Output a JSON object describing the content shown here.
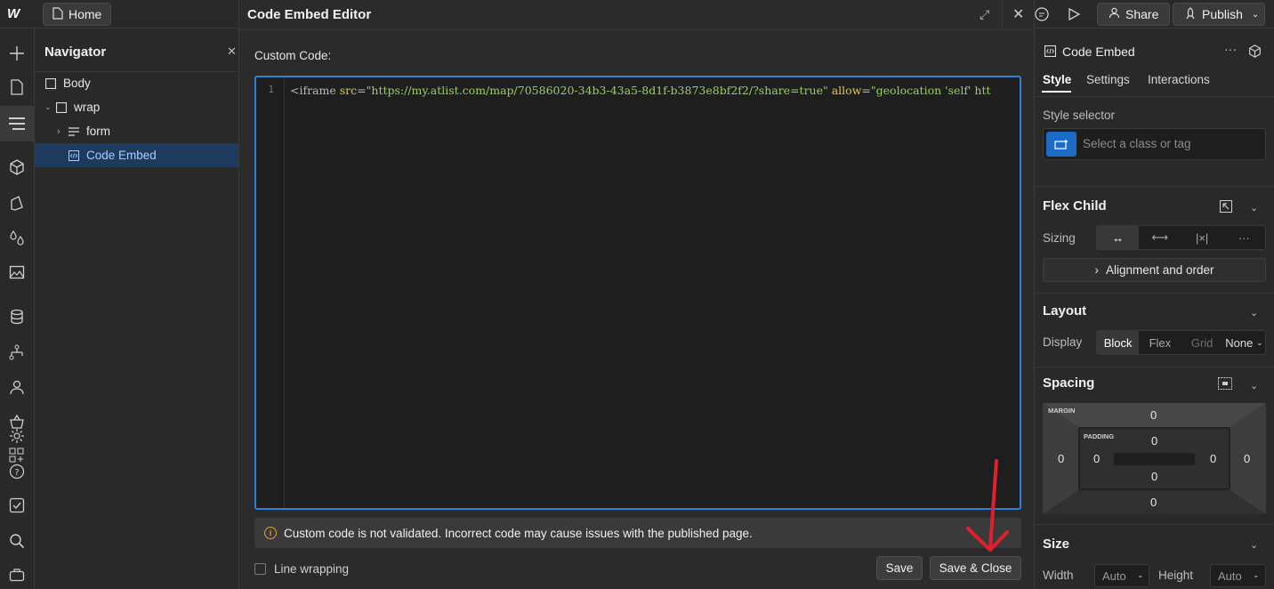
{
  "topbar": {
    "logo": "W",
    "page_label": "Home",
    "share_label": "Share",
    "publish_label": "Publish"
  },
  "navigator": {
    "title": "Navigator",
    "tree": [
      {
        "label": "Body",
        "icon": "square-icon",
        "indent": 0
      },
      {
        "label": "wrap",
        "icon": "square-icon",
        "indent": 1,
        "expanded": true
      },
      {
        "label": "form",
        "icon": "form-icon",
        "indent": 2,
        "expanded": false
      },
      {
        "label": "Code Embed",
        "icon": "code-embed-icon",
        "indent": 2,
        "selected": true
      }
    ]
  },
  "modal": {
    "title": "Code Embed Editor",
    "custom_code_label": "Custom Code:",
    "line_number": "1",
    "code": {
      "open": "<iframe",
      "attr1": "src",
      "eq": "=",
      "val1": "\"https://my.atlist.com/map/70586020-34b3-43a5-8d1f-b3873e8bf2f2/?share=true\"",
      "attr2": "allow",
      "val2": "\"geolocation 'self' htt"
    },
    "warning": "Custom code is not validated. Incorrect code may cause issues with the published page.",
    "line_wrapping_label": "Line wrapping",
    "save_label": "Save",
    "save_close_label": "Save & Close"
  },
  "right_panel": {
    "element_name": "Code Embed",
    "tabs": [
      "Style",
      "Settings",
      "Interactions"
    ],
    "active_tab": "Style",
    "style_selector_label": "Style selector",
    "selector_placeholder": "Select a class or tag",
    "flex_child_title": "Flex Child",
    "sizing_label": "Sizing",
    "alignment_label": "Alignment and order",
    "layout_title": "Layout",
    "display_label": "Display",
    "display_options": [
      "Block",
      "Flex",
      "Grid",
      "None"
    ],
    "display_active": "Block",
    "spacing_title": "Spacing",
    "margin_caption": "MARGIN",
    "padding_caption": "PADDING",
    "margin": {
      "top": "0",
      "right": "0",
      "bottom": "0",
      "left": "0"
    },
    "padding": {
      "top": "0",
      "right": "0",
      "bottom": "0",
      "left": "0"
    },
    "size_title": "Size",
    "width_label": "Width",
    "width_value": "Auto",
    "height_label": "Height",
    "height_value": "Auto",
    "unit_dash": "-"
  },
  "colors": {
    "accent": "#2f7fd4",
    "selected_row": "#1f3a5f",
    "annotation_arrow": "#e0202f",
    "warning_icon": "#d9a52b"
  }
}
